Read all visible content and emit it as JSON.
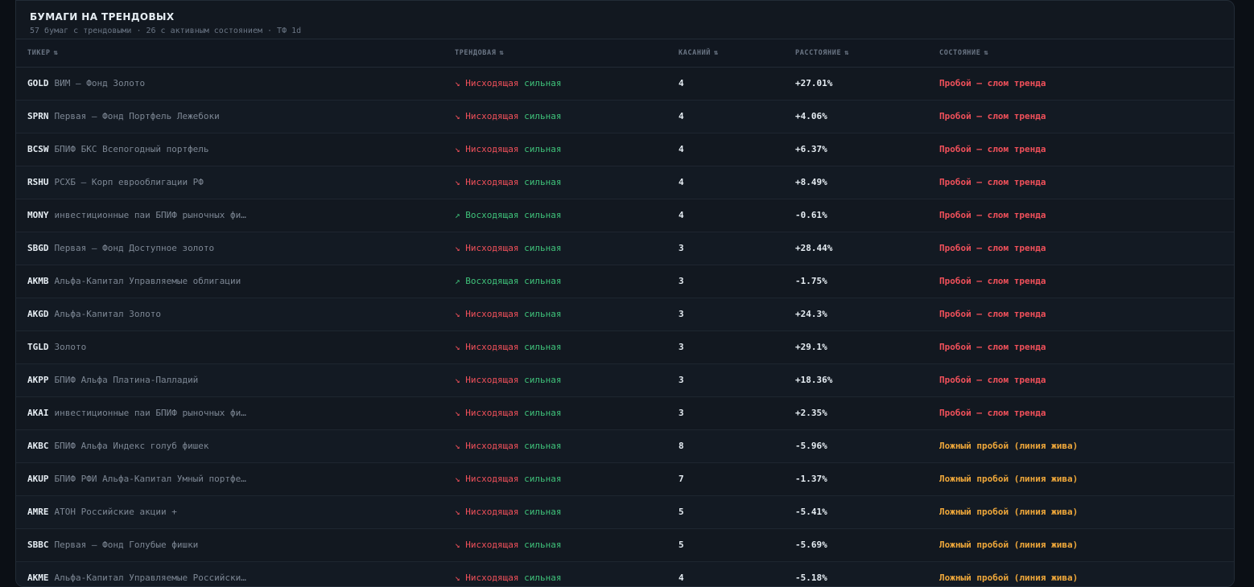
{
  "panel": {
    "title": "БУМАГИ НА ТРЕНДОВЫХ",
    "subtitle": "57 бумаг с трендовыми · 26 с активным состоянием · ТФ 1d"
  },
  "columns": {
    "ticker": "ТИКЕР",
    "trend": "ТРЕНДОВАЯ",
    "touches": "КАСАНИЙ",
    "distance": "РАССТОЯНИЕ",
    "state": "СОСТОЯНИЕ",
    "sort_glyph": "⇅"
  },
  "colors": {
    "down": "#f0505a",
    "up": "#3fc27a",
    "state_break": "#f0505a",
    "state_false": "#f0a83a"
  },
  "rows": [
    {
      "ticker": "GOLD",
      "name": "ВИМ – Фонд Золото",
      "trend": "↘ Нисходящая",
      "dir": "dn",
      "strength": "сильная",
      "touches": "4",
      "distance": "+27.01%",
      "state": "Пробой — слом тренда",
      "st": "break"
    },
    {
      "ticker": "SPRN",
      "name": "Первая – Фонд Портфель Лежебоки",
      "trend": "↘ Нисходящая",
      "dir": "dn",
      "strength": "сильная",
      "touches": "4",
      "distance": "+4.06%",
      "state": "Пробой — слом тренда",
      "st": "break"
    },
    {
      "ticker": "BCSW",
      "name": "БПИФ БКС Всепогодный портфель",
      "trend": "↘ Нисходящая",
      "dir": "dn",
      "strength": "сильная",
      "touches": "4",
      "distance": "+6.37%",
      "state": "Пробой — слом тренда",
      "st": "break"
    },
    {
      "ticker": "RSHU",
      "name": "РСХБ – Корп еврооблигации РФ",
      "trend": "↘ Нисходящая",
      "dir": "dn",
      "strength": "сильная",
      "touches": "4",
      "distance": "+8.49%",
      "state": "Пробой — слом тренда",
      "st": "break"
    },
    {
      "ticker": "MONY",
      "name": "инвестиционные паи БПИФ рыночных фи…",
      "trend": "↗ Восходящая",
      "dir": "up",
      "strength": "сильная",
      "touches": "4",
      "distance": "-0.61%",
      "state": "Пробой — слом тренда",
      "st": "break"
    },
    {
      "ticker": "SBGD",
      "name": "Первая – Фонд Доступное золото",
      "trend": "↘ Нисходящая",
      "dir": "dn",
      "strength": "сильная",
      "touches": "3",
      "distance": "+28.44%",
      "state": "Пробой — слом тренда",
      "st": "break"
    },
    {
      "ticker": "AKMB",
      "name": "Альфа-Капитал Управляемые облигации",
      "trend": "↗ Восходящая",
      "dir": "up",
      "strength": "сильная",
      "touches": "3",
      "distance": "-1.75%",
      "state": "Пробой — слом тренда",
      "st": "break"
    },
    {
      "ticker": "AKGD",
      "name": "Альфа-Капитал Золото",
      "trend": "↘ Нисходящая",
      "dir": "dn",
      "strength": "сильная",
      "touches": "3",
      "distance": "+24.3%",
      "state": "Пробой — слом тренда",
      "st": "break"
    },
    {
      "ticker": "TGLD",
      "name": "Золото",
      "trend": "↘ Нисходящая",
      "dir": "dn",
      "strength": "сильная",
      "touches": "3",
      "distance": "+29.1%",
      "state": "Пробой — слом тренда",
      "st": "break"
    },
    {
      "ticker": "AKPP",
      "name": "БПИФ Альфа Платина-Палладий",
      "trend": "↘ Нисходящая",
      "dir": "dn",
      "strength": "сильная",
      "touches": "3",
      "distance": "+18.36%",
      "state": "Пробой — слом тренда",
      "st": "break"
    },
    {
      "ticker": "AKAI",
      "name": "инвестиционные паи БПИФ рыночных фи…",
      "trend": "↘ Нисходящая",
      "dir": "dn",
      "strength": "сильная",
      "touches": "3",
      "distance": "+2.35%",
      "state": "Пробой — слом тренда",
      "st": "break"
    },
    {
      "ticker": "AKBC",
      "name": "БПИФ Альфа Индекс голуб фишек",
      "trend": "↘ Нисходящая",
      "dir": "dn",
      "strength": "сильная",
      "touches": "8",
      "distance": "-5.96%",
      "state": "Ложный пробой (линия жива)",
      "st": "false"
    },
    {
      "ticker": "AKUP",
      "name": "БПИФ РФИ Альфа-Капитал Умный портфе…",
      "trend": "↘ Нисходящая",
      "dir": "dn",
      "strength": "сильная",
      "touches": "7",
      "distance": "-1.37%",
      "state": "Ложный пробой (линия жива)",
      "st": "false"
    },
    {
      "ticker": "AMRE",
      "name": "АТОН Российские акции +",
      "trend": "↘ Нисходящая",
      "dir": "dn",
      "strength": "сильная",
      "touches": "5",
      "distance": "-5.41%",
      "state": "Ложный пробой (линия жива)",
      "st": "false"
    },
    {
      "ticker": "SBBC",
      "name": "Первая – Фонд Голубые фишки",
      "trend": "↘ Нисходящая",
      "dir": "dn",
      "strength": "сильная",
      "touches": "5",
      "distance": "-5.69%",
      "state": "Ложный пробой (линия жива)",
      "st": "false"
    },
    {
      "ticker": "AKME",
      "name": "Альфа-Капитал Управляемые Российски…",
      "trend": "↘ Нисходящая",
      "dir": "dn",
      "strength": "сильная",
      "touches": "4",
      "distance": "-5.18%",
      "state": "Ложный пробой (линия жива)",
      "st": "false"
    }
  ]
}
